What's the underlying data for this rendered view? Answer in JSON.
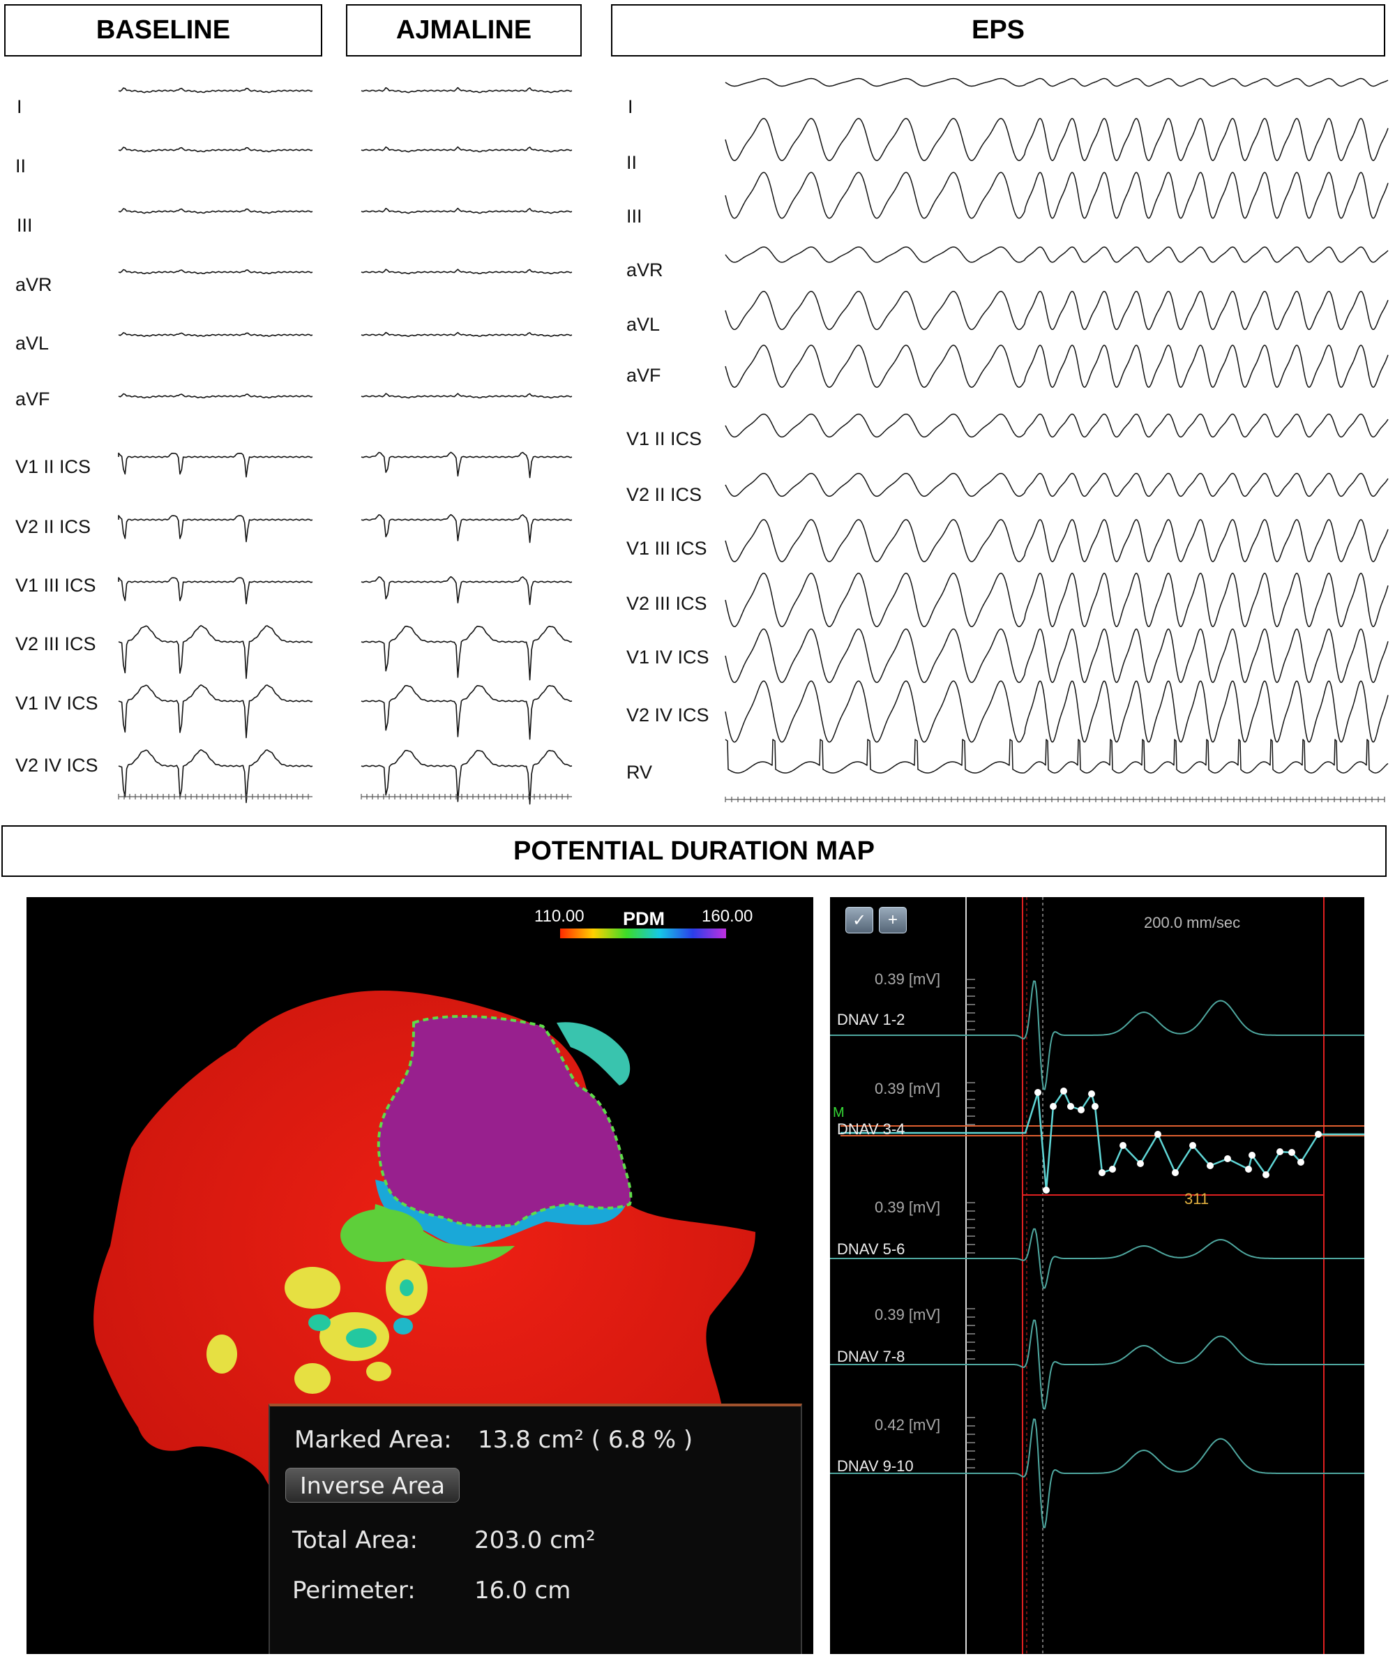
{
  "panels": {
    "baseline_title": "BASELINE",
    "ajmaline_title": "AJMALINE",
    "eps_title": "EPS",
    "pdm_section_title": "POTENTIAL DURATION MAP"
  },
  "ecg_leads": [
    "I",
    "II",
    "III",
    "aVR",
    "aVL",
    "aVF",
    "V1 II ICS",
    "V2 II ICS",
    "V1 III ICS",
    "V2 III ICS",
    "V1 IV ICS",
    "V2 IV ICS"
  ],
  "eps_leads": [
    "I",
    "II",
    "III",
    "aVR",
    "aVL",
    "aVF",
    "V1 II ICS",
    "V2 II ICS",
    "V1 III ICS",
    "V2 III ICS",
    "V1 IV ICS",
    "V2 IV ICS",
    "RV"
  ],
  "pdm_map": {
    "scale_min": "110.00",
    "scale_label": "PDM",
    "scale_max": "160.00",
    "colors": {
      "background": "#000000",
      "surface": "#dd1a10",
      "scar": "#9a1f8f",
      "border_dash": "#5fdc4a"
    }
  },
  "area_info": {
    "marked_area_label": "Marked Area:",
    "marked_area_value": "13.8 cm² ( 6.8 % )",
    "inverse_button": "Inverse Area",
    "total_area_label": "Total Area:",
    "total_area_value": "203.0 cm²",
    "perimeter_label": "Perimeter:",
    "perimeter_value": "16.0 cm"
  },
  "electrograms": {
    "speed": "200.0 mm/sec",
    "marker_label": "M",
    "duration_value": "311",
    "channels": [
      {
        "label": "DNAV 1-2",
        "gain": "0.39 [mV]"
      },
      {
        "label": "DNAV 3-4",
        "gain": "0.39 [mV]"
      },
      {
        "label": "DNAV 5-6",
        "gain": "0.39 [mV]"
      },
      {
        "label": "DNAV 7-8",
        "gain": "0.39 [mV]"
      },
      {
        "label": "DNAV 9-10",
        "gain": "0.42 [mV]"
      }
    ],
    "colors": {
      "trace": "#4fa8a0",
      "selected_trace": "#5fd6d6",
      "cursor": "#e02020"
    }
  }
}
